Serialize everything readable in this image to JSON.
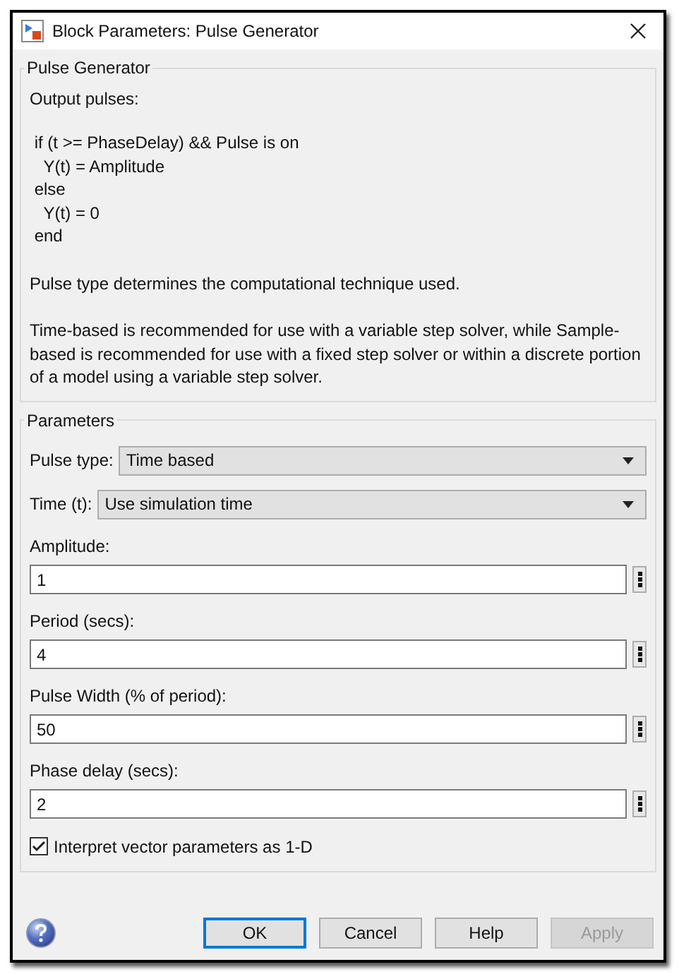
{
  "window": {
    "title": "Block Parameters: Pulse Generator"
  },
  "description": {
    "title": "Pulse Generator",
    "intro": "Output pulses:",
    "code_lines": [
      " if (t >= PhaseDelay) && Pulse is on",
      "   Y(t) = Amplitude",
      " else",
      "   Y(t) = 0",
      " end"
    ],
    "paragraphs": [
      "Pulse type determines the computational technique used.",
      "Time-based is recommended for use with a variable step solver, while Sample-based is recommended for use with a fixed step solver or within a discrete portion of a model using a variable step solver."
    ]
  },
  "parameters": {
    "title": "Parameters",
    "items": [
      {
        "kind": "dropdown",
        "label": "Pulse type:",
        "value": "Time based"
      },
      {
        "kind": "dropdown",
        "label": "Time (t):",
        "value": "Use simulation time"
      },
      {
        "kind": "field",
        "label": "Amplitude:",
        "value": "1"
      },
      {
        "kind": "field",
        "label": "Period (secs):",
        "value": "4"
      },
      {
        "kind": "field",
        "label": "Pulse Width (% of period):",
        "value": "50"
      },
      {
        "kind": "field",
        "label": "Phase delay (secs):",
        "value": "2"
      },
      {
        "kind": "checkbox",
        "label": "Interpret vector parameters as 1-D",
        "checked": true
      }
    ]
  },
  "buttons": [
    {
      "label": "OK",
      "default": true,
      "disabled": false
    },
    {
      "label": "Cancel",
      "default": false,
      "disabled": false
    },
    {
      "label": "Help",
      "default": false,
      "disabled": false
    },
    {
      "label": "Apply",
      "default": false,
      "disabled": true
    }
  ]
}
